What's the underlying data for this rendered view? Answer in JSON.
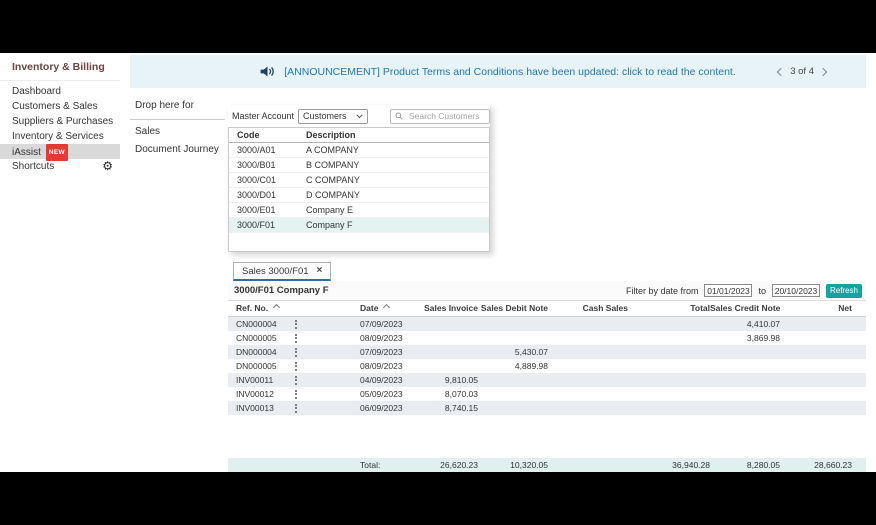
{
  "sidebar": {
    "title": "Inventory & Billing",
    "items": [
      {
        "label": "Dashboard"
      },
      {
        "label": "Customers & Sales"
      },
      {
        "label": "Suppliers & Purchases"
      },
      {
        "label": "Inventory & Services"
      },
      {
        "label": "iAssist",
        "badge": "NEW",
        "selected": true
      },
      {
        "label": "Shortcuts",
        "icon": "gear-icon"
      }
    ]
  },
  "banner": {
    "icon": "speaker-icon",
    "text": "[ANNOUNCEMENT] Product Terms and Conditions have been updated: click to read the content.",
    "pagination": "3 of 4"
  },
  "drop_panel": {
    "title": "Drop here for",
    "items": [
      {
        "label": "Sales"
      },
      {
        "label": "Document Journey"
      }
    ]
  },
  "master_panel": {
    "label": "Master Account",
    "dropdown_value": "Customers",
    "search_placeholder": "Search Customers",
    "table": {
      "headers": {
        "code": "Code",
        "description": "Description"
      },
      "rows": [
        {
          "code": "3000/A01",
          "description": "A COMPANY"
        },
        {
          "code": "3000/B01",
          "description": "B COMPANY"
        },
        {
          "code": "3000/C01",
          "description": "C COMPANY"
        },
        {
          "code": "3000/D01",
          "description": "D COMPANY"
        },
        {
          "code": "3000/E01",
          "description": "Company E"
        },
        {
          "code": "3000/F01",
          "description": "Company F",
          "selected": true
        }
      ]
    }
  },
  "tab": {
    "label": "Sales 3000/F01",
    "close_icon": "×"
  },
  "detail": {
    "title": "3000/F01 Company F",
    "filter": {
      "label": "Filter by date from",
      "from": "01/01/2023",
      "to_label": "to",
      "to": "20/10/2023",
      "refresh_label": "Refresh"
    },
    "table": {
      "headers": {
        "ref": "Ref. No.",
        "date": "Date",
        "invoice": "Sales Invoice",
        "debit": "Sales Debit Note",
        "cash": "Cash Sales",
        "total": "Total",
        "credit": "Sales Credit Note",
        "net": "Net"
      },
      "rows": [
        {
          "ref": "CN000004",
          "date": "07/09/2023",
          "credit": "4,410.07"
        },
        {
          "ref": "CN000005",
          "date": "08/09/2023",
          "credit": "3,869.98"
        },
        {
          "ref": "DN000004",
          "date": "07/09/2023",
          "debit": "5,430.07"
        },
        {
          "ref": "DN000005",
          "date": "08/09/2023",
          "debit": "4,889.98"
        },
        {
          "ref": "INV00011",
          "date": "04/09/2023",
          "invoice": "9,810.05"
        },
        {
          "ref": "INV00012",
          "date": "05/09/2023",
          "invoice": "8,070.03"
        },
        {
          "ref": "INV00013",
          "date": "06/09/2023",
          "invoice": "8,740.15"
        }
      ],
      "total_row": {
        "label": "Total:",
        "invoice": "26,620.23",
        "debit": "10,320.05",
        "total": "36,940.28",
        "credit": "8,280.05",
        "net": "28,660.23"
      }
    }
  },
  "colors": {
    "accent_teal": "#14a39f",
    "badge_red": "#e23b36",
    "banner_bg": "#e8f3f7",
    "banner_text": "#2077b4",
    "sidebar_title": "#6d4343",
    "sidebar_selected_bg": "#d9d9d9",
    "row_stripe": "#e9edf2",
    "customer_selected_row": "#e4f2f0",
    "total_row_bg": "#dff0ef",
    "tab_indicator": "#2e6da4"
  }
}
